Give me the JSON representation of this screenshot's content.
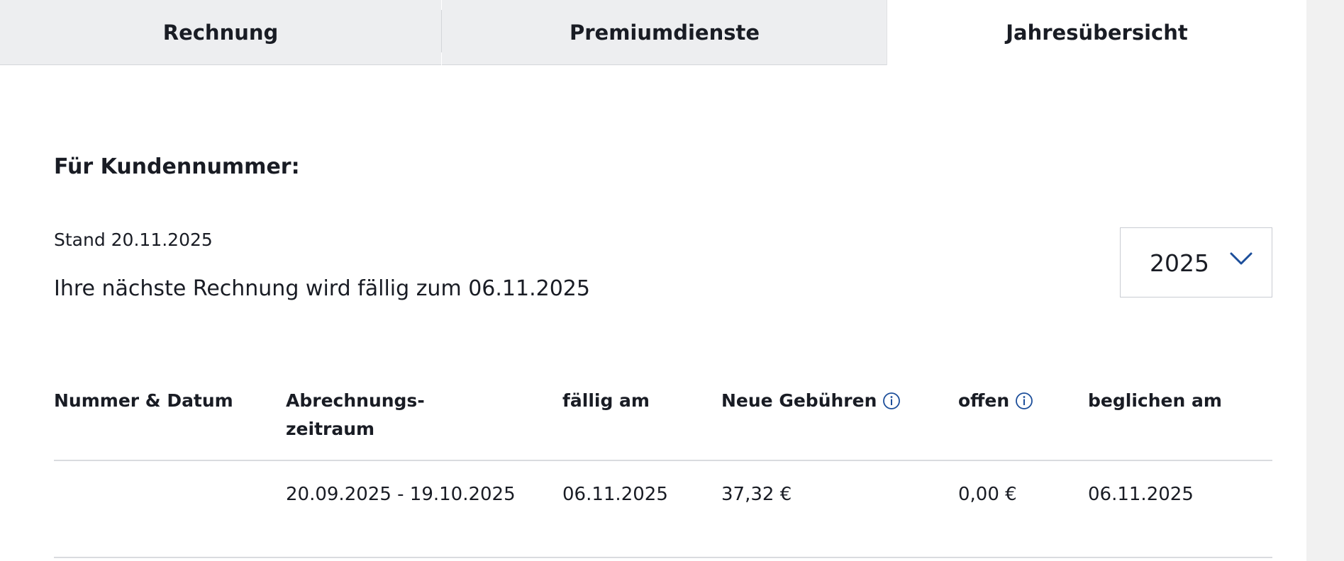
{
  "tabs": [
    {
      "label": "Rechnung",
      "active": false
    },
    {
      "label": "Premiumdienste",
      "active": false
    },
    {
      "label": "Jahresübersicht",
      "active": true
    }
  ],
  "content": {
    "heading": "Für Kundennummer:",
    "stand": "Stand 20.11.2025",
    "next_bill": "Ihre nächste Rechnung wird fällig zum 06.11.2025",
    "year_select": {
      "selected": "2025",
      "icon": "chevron-down-icon"
    }
  },
  "table": {
    "headers": {
      "number_date": "Nummer & Datum",
      "period_line1": "Abrechnungs-",
      "period_line2": "zeitraum",
      "due": "fällig am",
      "new_fees": "Neue Gebühren",
      "open": "offen",
      "paid_on": "beglichen am"
    },
    "rows": [
      {
        "number_date": "",
        "period": "20.09.2025 - 19.10.2025",
        "due": "06.11.2025",
        "new_fees": "37,32 €",
        "open": "0,00 €",
        "paid_on": "06.11.2025"
      }
    ]
  },
  "colors": {
    "accent": "#1c4e9a",
    "tab_inactive_bg": "#edeef0",
    "divider": "#d9dbdf",
    "text": "#191c24"
  }
}
